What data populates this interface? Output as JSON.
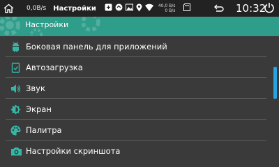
{
  "statusbar": {
    "speed": "0,0B/s",
    "title": "Настройки",
    "net_up": "40,0 B/s",
    "net_down": "0 B/s",
    "time": "10:32",
    "icons": [
      "home-icon",
      "usb-icon",
      "app-icon",
      "image-icon",
      "location-icon",
      "wifi-icon",
      "sdcard-icon",
      "back-icon",
      "power-icon"
    ]
  },
  "appbar": {
    "title": "Настройки",
    "color": "#2e9d89"
  },
  "list": {
    "items": [
      {
        "label": "Боковая панель для приложений",
        "icon": "android-icon"
      },
      {
        "label": "Автозагрузка",
        "icon": "autostart-icon"
      },
      {
        "label": "Звук",
        "icon": "speaker-icon"
      },
      {
        "label": "Экран",
        "icon": "brightness-icon"
      },
      {
        "label": "Палитра",
        "icon": "palette-icon"
      },
      {
        "label": "Настройки скриншота",
        "icon": "camera-icon"
      }
    ]
  },
  "colors": {
    "background": "#3a3a3a",
    "icon": "#35b6a6",
    "scroll_thumb": "#2aa2e0"
  }
}
